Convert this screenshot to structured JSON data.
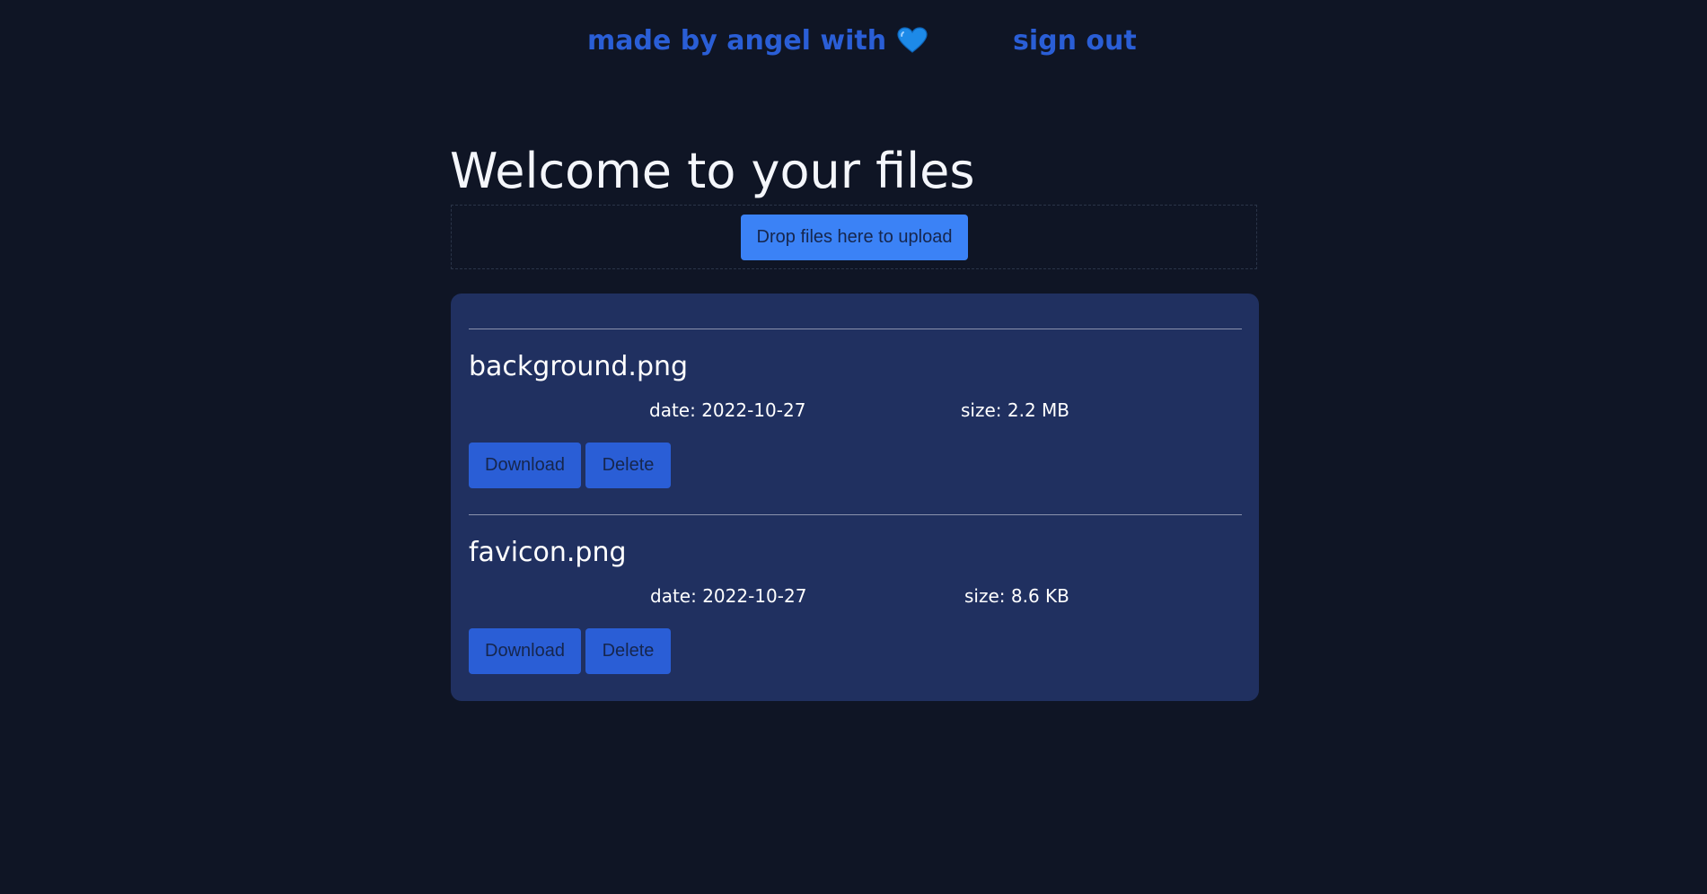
{
  "header": {
    "credit_text": "made by angel with",
    "heart_icon": "blue-heart-icon",
    "signout_label": "sign out"
  },
  "main": {
    "title": "Welcome to your files",
    "upload_label": "Drop files here to upload"
  },
  "files": [
    {
      "name": "background.png",
      "date": "date: 2022-10-27",
      "size": "size: 2.2 MB",
      "download_label": "Download",
      "delete_label": "Delete"
    },
    {
      "name": "favicon.png",
      "date": "date: 2022-10-27",
      "size": "size: 8.6 KB",
      "download_label": "Download",
      "delete_label": "Delete"
    }
  ],
  "colors": {
    "background": "#0f1525",
    "accent": "#2a5ed6",
    "upload_button": "#3b82f6",
    "card": "#203060"
  }
}
